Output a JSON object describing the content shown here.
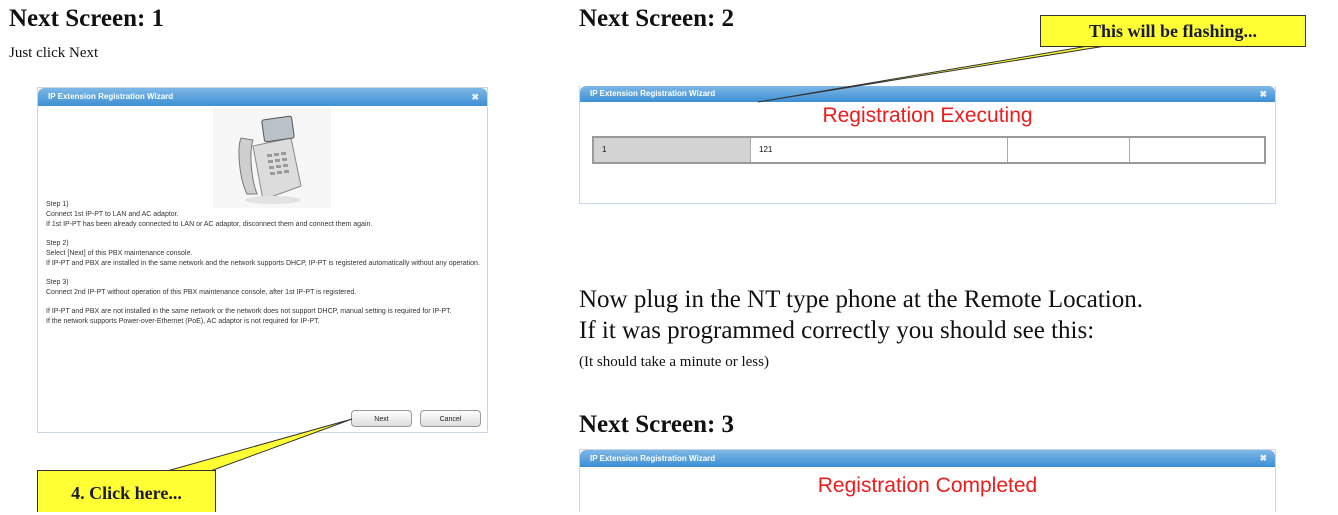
{
  "left": {
    "heading": "Next Screen:  1",
    "instruction": "Just click Next"
  },
  "right": {
    "heading2": "Next Screen: 2",
    "body_line1": "Now plug in the NT type phone at the Remote Location.",
    "body_line2": "If it was programmed correctly you should see this:",
    "note": "(It  should take a minute or less)",
    "heading3": "Next Screen: 3"
  },
  "wizard1": {
    "title": "IP Extension Registration Wizard",
    "close": "✖",
    "steps": [
      {
        "label": "Step 1)",
        "lines": [
          "Connect 1st IP-PT to LAN and AC adaptor.",
          "If 1st IP-PT has been already connected to LAN or AC adaptor, disconnect them and connect them again."
        ]
      },
      {
        "label": "Step 2)",
        "lines": [
          "Select [Next] of this PBX maintenance console.",
          "If IP-PT and PBX are installed in the same network and the network supports DHCP, IP-PT is registered automatically without any operation."
        ]
      },
      {
        "label": "Step 3)",
        "lines": [
          "Connect 2nd IP-PT without operation of this PBX maintenance console, after 1st IP-PT is registered."
        ]
      }
    ],
    "note1": "If IP-PT and PBX are not installed in the same network or the network does not support DHCP, manual setting is required for IP-PT.",
    "note2": "If the network supports Power-over-Ethernet (PoE), AC adaptor is not required for IP-PT.",
    "next_label": "Next",
    "cancel_label": "Cancel"
  },
  "wizard2": {
    "title": "IP Extension Registration Wizard",
    "close": "✖",
    "status": "Registration Executing",
    "row": [
      "1",
      "121",
      "",
      ""
    ]
  },
  "wizard3": {
    "title": "IP Extension Registration Wizard",
    "close": "✖",
    "status": "Registration Completed"
  },
  "callouts": {
    "flashing": "This will be flashing...",
    "click_here": "4. Click here..."
  },
  "colors": {
    "callout_fill": "#ffff33",
    "status_red": "#ec1c1c",
    "title_bar_blue": "#3c8fd3"
  }
}
